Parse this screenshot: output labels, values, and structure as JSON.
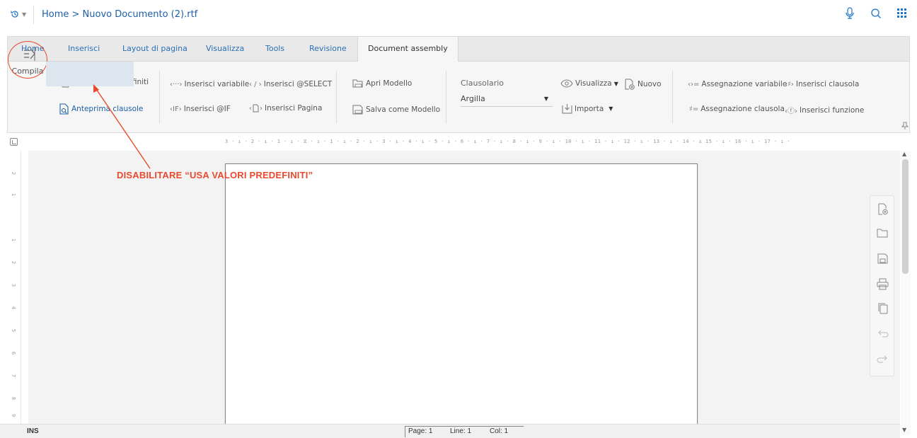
{
  "topbar": {
    "breadcrumb": "Home > Nuovo Documento (2).rtf",
    "icons": [
      "history-icon",
      "microphone-icon",
      "search-icon",
      "apps-grid-icon"
    ]
  },
  "ribbon": {
    "tabs": [
      {
        "label": "Home"
      },
      {
        "label": "Inserisci"
      },
      {
        "label": "Layout di pagina"
      },
      {
        "label": "Visualizza"
      },
      {
        "label": "Tools"
      },
      {
        "label": "Revisione"
      },
      {
        "label": "Document assembly",
        "active": true
      }
    ],
    "compila": "Compila",
    "usa_valori": "Usa valori predefiniti",
    "anteprima": "Anteprima clausole",
    "inserisci_variabile_glyph": "‹···›",
    "inserisci_variabile": "Inserisci variabile",
    "inserisci_select_glyph": "‹ / ›",
    "inserisci_select": "Inserisci @SELECT",
    "inserisci_if_glyph": "‹IF›",
    "inserisci_if": "Inserisci @IF",
    "inserisci_pagina_glyph": "‹",
    "inserisci_pagina_glyph2": "›",
    "inserisci_pagina": "Inserisci Pagina",
    "apri_modello": "Apri Modello",
    "salva_modello": "Salva come Modello",
    "clausolario_label": "Clausolario",
    "clausolario_value": "Argilla",
    "visualizza": "Visualizza",
    "nuovo": "Nuovo",
    "importa": "Importa",
    "assegnazione_variabile_glyph": "‹›=",
    "assegnazione_variabile": "Assegnazione variabile",
    "inserisci_clausola_glyph": "‹♯›",
    "inserisci_clausola": "Inserisci clausola",
    "assegnazione_clausola_glyph": "♯=",
    "assegnazione_clausola": "Assegnazione clausola",
    "inserisci_funzione_glyph": "‹ⓕ›",
    "inserisci_funzione": "Inserisci funzione"
  },
  "ruler": {
    "horizontal": "3 · ı · 2 · ı · 1 · ı · ⧖ · ı · 1 · ı · 2 · ı · 3 · ı · 4 · ı · 5 · ı · 6 · ı · 7 · ı · 8 · ı · 9 · ı · 10 · ı · 11 · ı · 12 · ı · 13 · ı · 14 · ⏃ 15 · ı · 16 · ı · 17 · ı ·",
    "vertical_ticks": [
      "2",
      "1",
      "1",
      "2",
      "3",
      "4",
      "5",
      "6",
      "7",
      "8",
      "9"
    ]
  },
  "annotation": {
    "text": "DISABILITARE “USA VALORI PREDEFINITI”",
    "color": "#e74a2e"
  },
  "statusbar": {
    "mode": "INS",
    "page": "Page: 1",
    "line": "Line: 1",
    "col": "Col: 1"
  },
  "side_tools": [
    "new-document-icon",
    "open-folder-icon",
    "save-icon",
    "print-icon",
    "copy-icon",
    "undo-icon",
    "redo-icon"
  ],
  "colors": {
    "accent": "#1d5fa8",
    "annotation": "#e74a2e",
    "selected_bg": "#dde6ef"
  }
}
